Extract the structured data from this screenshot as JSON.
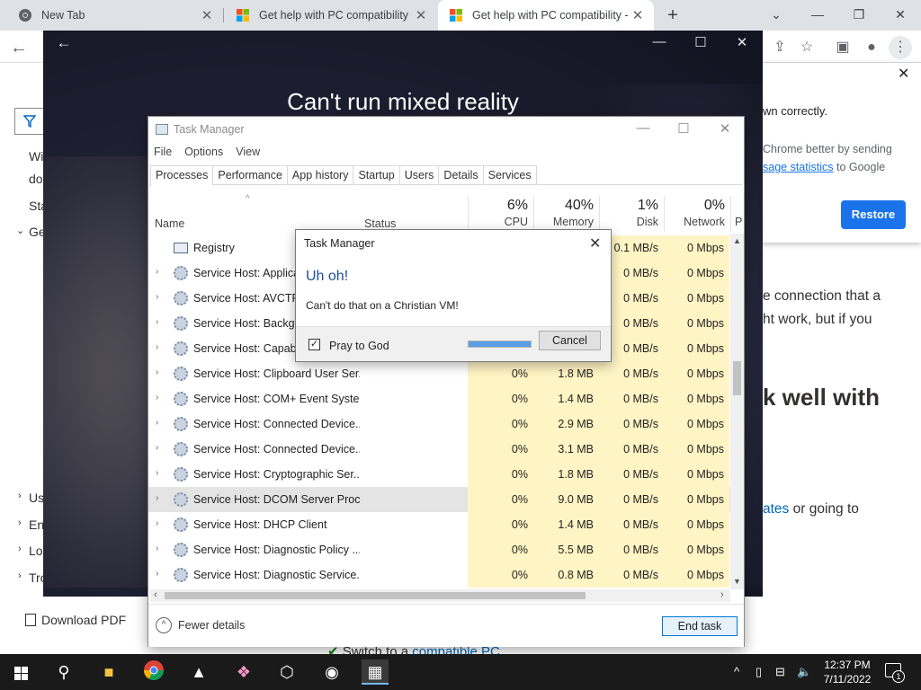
{
  "browser": {
    "tabs": [
      {
        "title": "New Tab",
        "active": false
      },
      {
        "title": "Get help with PC compatibility - ",
        "active": false
      },
      {
        "title": "Get help with PC compatibility - ",
        "active": true
      }
    ],
    "new_tab_glyph": "+",
    "window_controls": {
      "minimize": "⌄",
      "restore": "❐",
      "close": "✕"
    }
  },
  "page_behind": {
    "left_fragments": [
      "Wi",
      "do",
      "Sta",
      "Ge",
      "Us",
      "En",
      "Lo",
      "Tro"
    ],
    "download_pdf": "Download PDF",
    "right_fragments": [
      "e connection that a",
      "ht work, but if you",
      "k well with",
      "ates or going to"
    ],
    "right_link_word": "ates",
    "right_suffix": " or going to",
    "switch_line_prefix": "Switch to a ",
    "switch_line_link": "compatible PC"
  },
  "chrome_popup": {
    "heading": "wn correctly.",
    "body_prefix": "Chrome better by sending",
    "body_link": "sage statistics",
    "body_suffix": " to Google",
    "restore_label": "Restore",
    "accent": "#1a73e8"
  },
  "dark_window": {
    "title": "Can't run mixed reality"
  },
  "task_manager": {
    "title": "Task Manager",
    "menu": [
      "File",
      "Options",
      "View"
    ],
    "tabs": [
      "Processes",
      "Performance",
      "App history",
      "Startup",
      "Users",
      "Details",
      "Services"
    ],
    "selected_tab": "Processes",
    "columns": {
      "name": "Name",
      "status": "Status",
      "cpu": {
        "pct": "6%",
        "label": "CPU"
      },
      "memory": {
        "pct": "40%",
        "label": "Memory"
      },
      "disk": {
        "pct": "1%",
        "label": "Disk"
      },
      "network": {
        "pct": "0%",
        "label": "Network"
      },
      "power": "P"
    },
    "rows": [
      {
        "name": "Registry",
        "cpu": "",
        "mem": "",
        "disk": "0.1 MB/s",
        "net": "0 Mbps",
        "expandable": false,
        "icon": "registry-icon"
      },
      {
        "name": "Service Host: Applicat",
        "cpu": "",
        "mem": "",
        "disk": "0 MB/s",
        "net": "0 Mbps",
        "expandable": true,
        "icon": "gear-icon"
      },
      {
        "name": "Service Host: AVCTP s",
        "cpu": "",
        "mem": "",
        "disk": "0 MB/s",
        "net": "0 Mbps",
        "expandable": true,
        "icon": "gear-icon"
      },
      {
        "name": "Service Host: Backgro",
        "cpu": "",
        "mem": "",
        "disk": "0 MB/s",
        "net": "0 Mbps",
        "expandable": true,
        "icon": "gear-icon"
      },
      {
        "name": "Service Host: Capabili",
        "cpu": "",
        "mem": "",
        "disk": "0 MB/s",
        "net": "0 Mbps",
        "expandable": true,
        "icon": "gear-icon"
      },
      {
        "name": "Service Host: Clipboard User Ser...",
        "cpu": "0%",
        "mem": "1.8 MB",
        "disk": "0 MB/s",
        "net": "0 Mbps",
        "expandable": true,
        "icon": "gear-icon"
      },
      {
        "name": "Service Host: COM+ Event Syste...",
        "cpu": "0%",
        "mem": "1.4 MB",
        "disk": "0 MB/s",
        "net": "0 Mbps",
        "expandable": true,
        "icon": "gear-icon"
      },
      {
        "name": "Service Host: Connected Device...",
        "cpu": "0%",
        "mem": "2.9 MB",
        "disk": "0 MB/s",
        "net": "0 Mbps",
        "expandable": true,
        "icon": "gear-icon"
      },
      {
        "name": "Service Host: Connected Device...",
        "cpu": "0%",
        "mem": "3.1 MB",
        "disk": "0 MB/s",
        "net": "0 Mbps",
        "expandable": true,
        "icon": "gear-icon"
      },
      {
        "name": "Service Host: Cryptographic Ser...",
        "cpu": "0%",
        "mem": "1.8 MB",
        "disk": "0 MB/s",
        "net": "0 Mbps",
        "expandable": true,
        "icon": "gear-icon"
      },
      {
        "name": "Service Host: DCOM Server Proc...",
        "cpu": "0%",
        "mem": "9.0 MB",
        "disk": "0 MB/s",
        "net": "0 Mbps",
        "expandable": true,
        "icon": "gear-icon",
        "highlighted": true
      },
      {
        "name": "Service Host: DHCP Client",
        "cpu": "0%",
        "mem": "1.4 MB",
        "disk": "0 MB/s",
        "net": "0 Mbps",
        "expandable": true,
        "icon": "gear-icon"
      },
      {
        "name": "Service Host: Diagnostic Policy ...",
        "cpu": "0%",
        "mem": "5.5 MB",
        "disk": "0 MB/s",
        "net": "0 Mbps",
        "expandable": true,
        "icon": "gear-icon"
      },
      {
        "name": "Service Host: Diagnostic Service...",
        "cpu": "0%",
        "mem": "0.8 MB",
        "disk": "0 MB/s",
        "net": "0 Mbps",
        "expandable": true,
        "icon": "gear-icon"
      }
    ],
    "fewer_details": "Fewer details",
    "end_task": "End task"
  },
  "dialog": {
    "title": "Task Manager",
    "heading": "Uh oh!",
    "message": "Can't do that on a Christian VM!",
    "checkbox_label": "Pray to God",
    "checkbox_checked": true,
    "progress_fraction": 1.0,
    "cancel_label": "Cancel",
    "heading_color": "#1f4e9c"
  },
  "taskbar": {
    "time": "12:37 PM",
    "date": "7/11/2022",
    "notification_count": "1",
    "pinned": [
      "file-explorer-icon",
      "chrome-icon",
      "photos-icon",
      "paint-icon",
      "3d-viewer-icon",
      "mixed-reality-icon",
      "task-manager-icon"
    ]
  }
}
